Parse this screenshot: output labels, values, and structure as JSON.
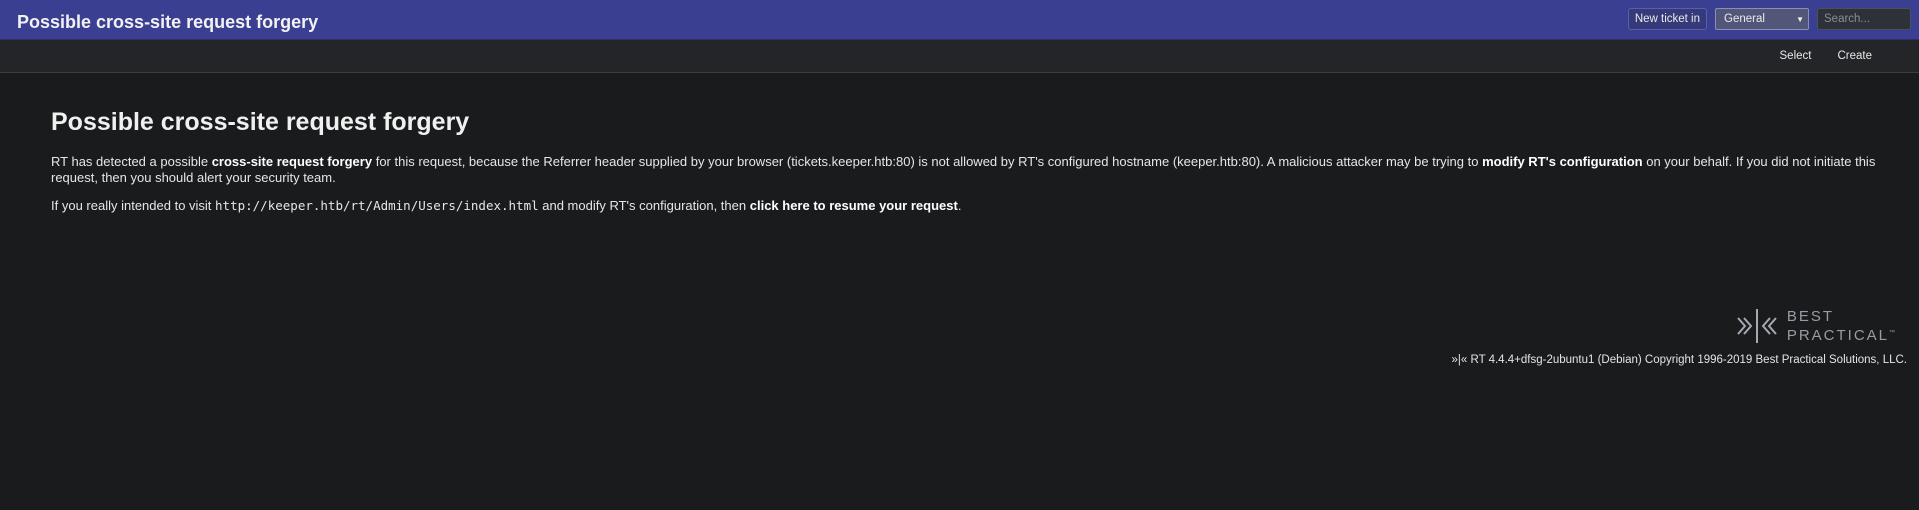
{
  "header": {
    "title": "Possible cross-site request forgery",
    "new_ticket_label": "New ticket in",
    "queue_selected": "General",
    "search_placeholder": "Search..."
  },
  "subnav": {
    "items": [
      "Select",
      "Create"
    ]
  },
  "main": {
    "heading": "Possible cross-site request forgery",
    "p1": {
      "t1": "RT has detected a possible ",
      "b1": "cross-site request forgery",
      "t2": " for this request, because the Referrer header supplied by your browser (tickets.keeper.htb:80) is not allowed by RT's configured hostname (keeper.htb:80). A malicious attacker may be trying to ",
      "b2": "modify RT's configuration",
      "t3": " on your behalf. If you did not initiate this request, then you should alert your security team."
    },
    "p2": {
      "t1": "If you really intended to visit ",
      "url": "http://keeper.htb/rt/Admin/Users/index.html",
      "t2": " and modify RT's configuration, then ",
      "link": "click here to resume your request",
      "t3": "."
    }
  },
  "logo": {
    "line1": "BEST",
    "line2": "PRACTICAL",
    "tm": "™"
  },
  "footer": {
    "text": "»|« RT 4.4.4+dfsg-2ubuntu1 (Debian) Copyright 1996-2019 Best Practical Solutions, LLC."
  }
}
